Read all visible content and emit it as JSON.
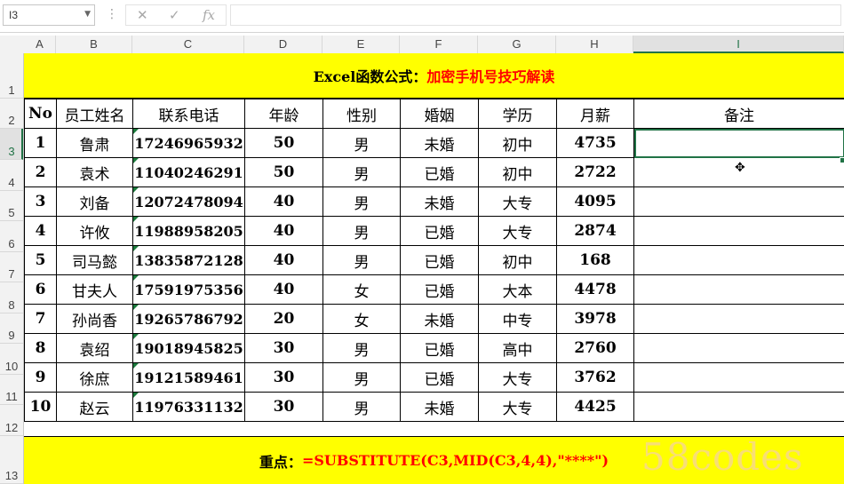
{
  "formula_bar": {
    "name_box": "I3",
    "icons": [
      "more-dots-icon",
      "cancel-x-icon",
      "enter-check-icon",
      "insert-function-icon"
    ],
    "fx_label": "fx",
    "formula": ""
  },
  "columns": [
    "A",
    "B",
    "C",
    "D",
    "E",
    "F",
    "G",
    "H",
    "I"
  ],
  "selected_column": "I",
  "rows": [
    "1",
    "2",
    "3",
    "4",
    "5",
    "6",
    "7",
    "8",
    "9",
    "10",
    "11",
    "12",
    "13"
  ],
  "selected_row": "3",
  "title": {
    "part1": "Excel函数公式：",
    "part2": "加密手机号技巧解读"
  },
  "table": {
    "headers": [
      "No",
      "员工姓名",
      "联系电话",
      "年龄",
      "性别",
      "婚姻",
      "学历",
      "月薪",
      "备注"
    ],
    "rows": [
      [
        "1",
        "鲁肃",
        "17246965932",
        "50",
        "男",
        "未婚",
        "初中",
        "4735",
        ""
      ],
      [
        "2",
        "袁术",
        "11040246291",
        "50",
        "男",
        "已婚",
        "初中",
        "2722",
        ""
      ],
      [
        "3",
        "刘备",
        "12072478094",
        "40",
        "男",
        "未婚",
        "大专",
        "4095",
        ""
      ],
      [
        "4",
        "许攸",
        "11988958205",
        "40",
        "男",
        "已婚",
        "大专",
        "2874",
        ""
      ],
      [
        "5",
        "司马懿",
        "13835872128",
        "40",
        "男",
        "已婚",
        "初中",
        "168",
        ""
      ],
      [
        "6",
        "甘夫人",
        "17591975356",
        "40",
        "女",
        "已婚",
        "大本",
        "4478",
        ""
      ],
      [
        "7",
        "孙尚香",
        "19265786792",
        "20",
        "女",
        "未婚",
        "中专",
        "3978",
        ""
      ],
      [
        "8",
        "袁绍",
        "19018945825",
        "30",
        "男",
        "已婚",
        "高中",
        "2760",
        ""
      ],
      [
        "9",
        "徐庶",
        "19121589461",
        "30",
        "男",
        "已婚",
        "大专",
        "3762",
        ""
      ],
      [
        "10",
        "赵云",
        "11976331132",
        "30",
        "男",
        "未婚",
        "大专",
        "4425",
        ""
      ]
    ]
  },
  "footer": {
    "label": "重点：",
    "formula": "=SUBSTITUTE(C3,MID(C3,4,4),\"****\")"
  },
  "watermark": "58codes",
  "colors": {
    "banner": "#ffff00",
    "accent": "#217346",
    "title_red": "#ff0000"
  }
}
